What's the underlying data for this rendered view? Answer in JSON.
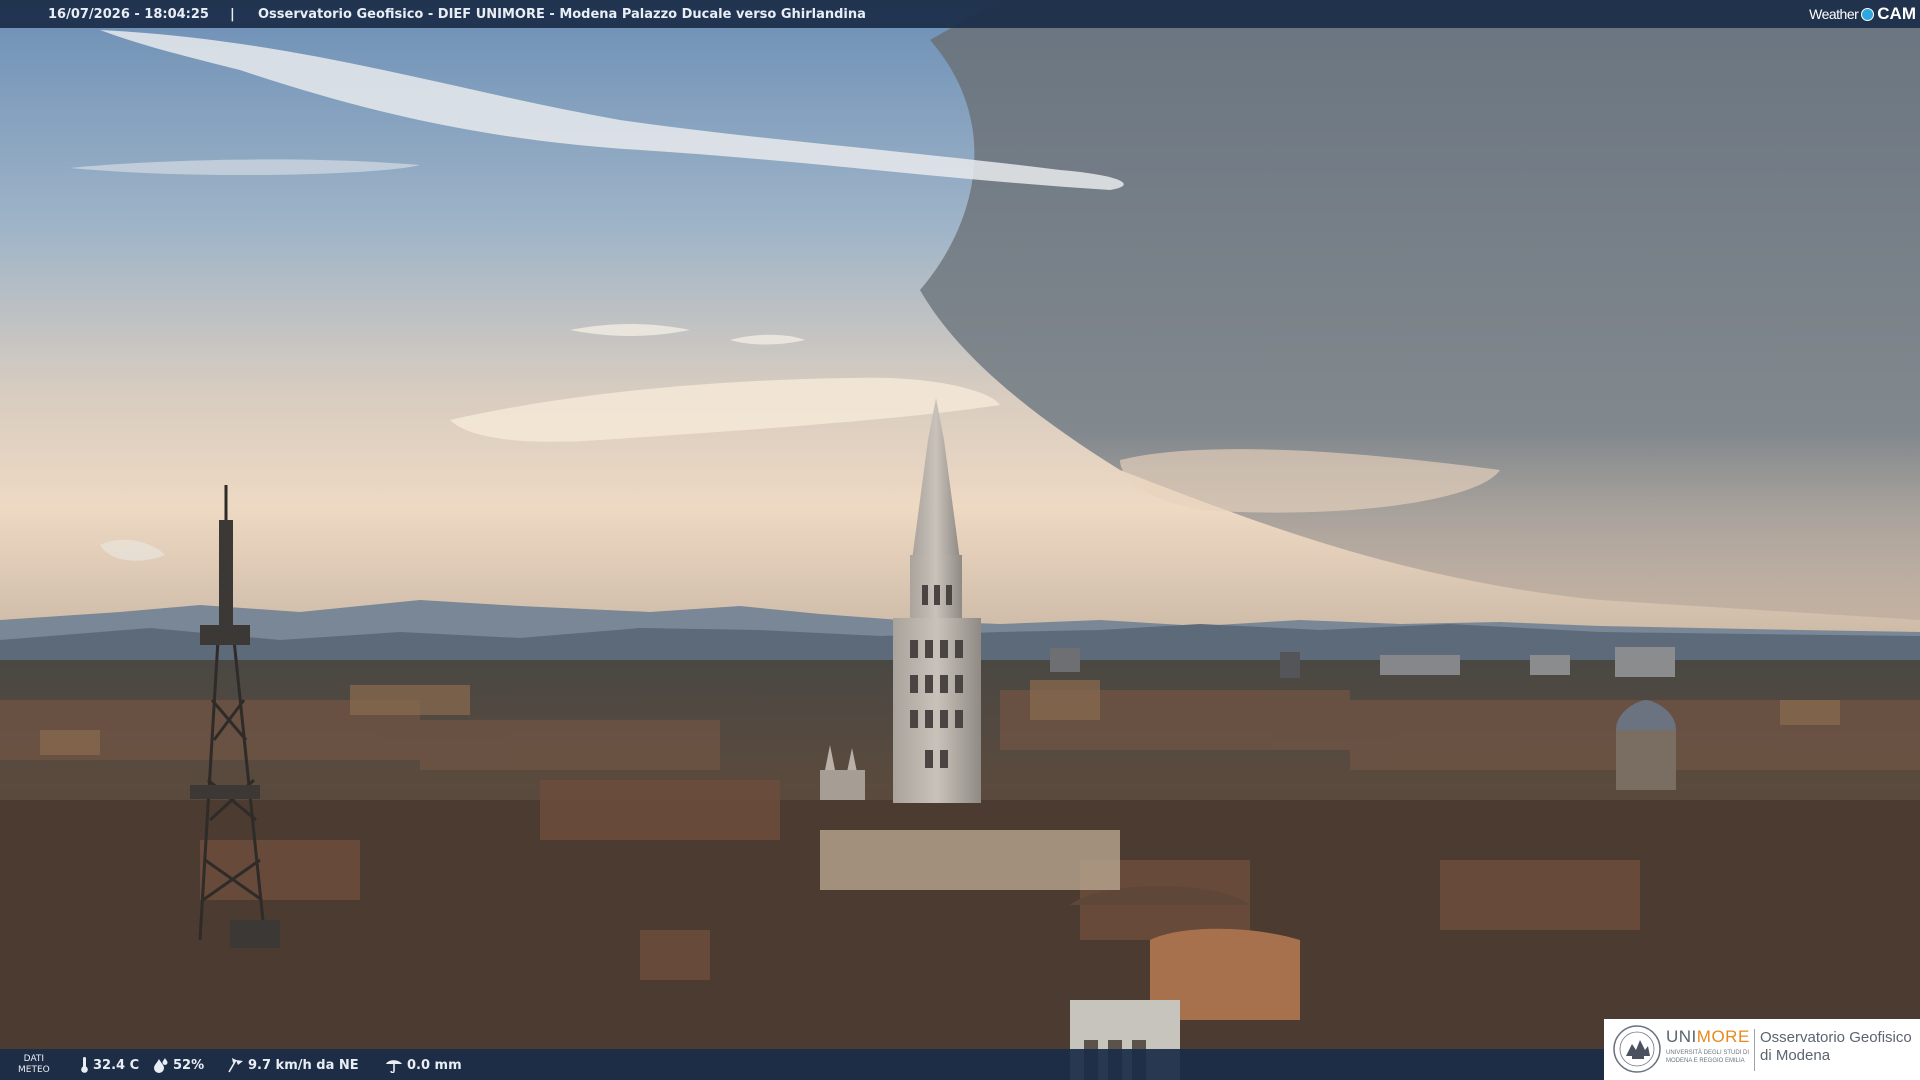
{
  "header": {
    "datetime": "16/07/2026 - 18:04:25",
    "separator": "|",
    "title": "Osservatorio Geofisico - DIEF UNIMORE - Modena Palazzo Ducale verso Ghirlandina",
    "brand_left": "Weather",
    "brand_right": "CAM"
  },
  "meteo": {
    "label_line1": "DATI",
    "label_line2": "METEO",
    "temperature": "32.4 C",
    "humidity": "52%",
    "wind": "9.7 km/h da NE",
    "rain": "0.0 mm",
    "icons": [
      "thermometer-icon",
      "humidity-drop-icon",
      "wind-icon",
      "rain-gauge-icon"
    ]
  },
  "logo": {
    "uni": "UNI",
    "more": "MORE",
    "sub_line1": "UNIVERSITÀ DEGLI STUDI DI",
    "sub_line2": "MODENA E REGGIO EMILIA",
    "osservatorio_line1": "Osservatorio Geofisico",
    "osservatorio_line2": "di Modena"
  },
  "colors": {
    "bar_background": "#1a2c48",
    "unimore_orange": "#e8891d",
    "brand_blue": "#2ea7e0"
  }
}
